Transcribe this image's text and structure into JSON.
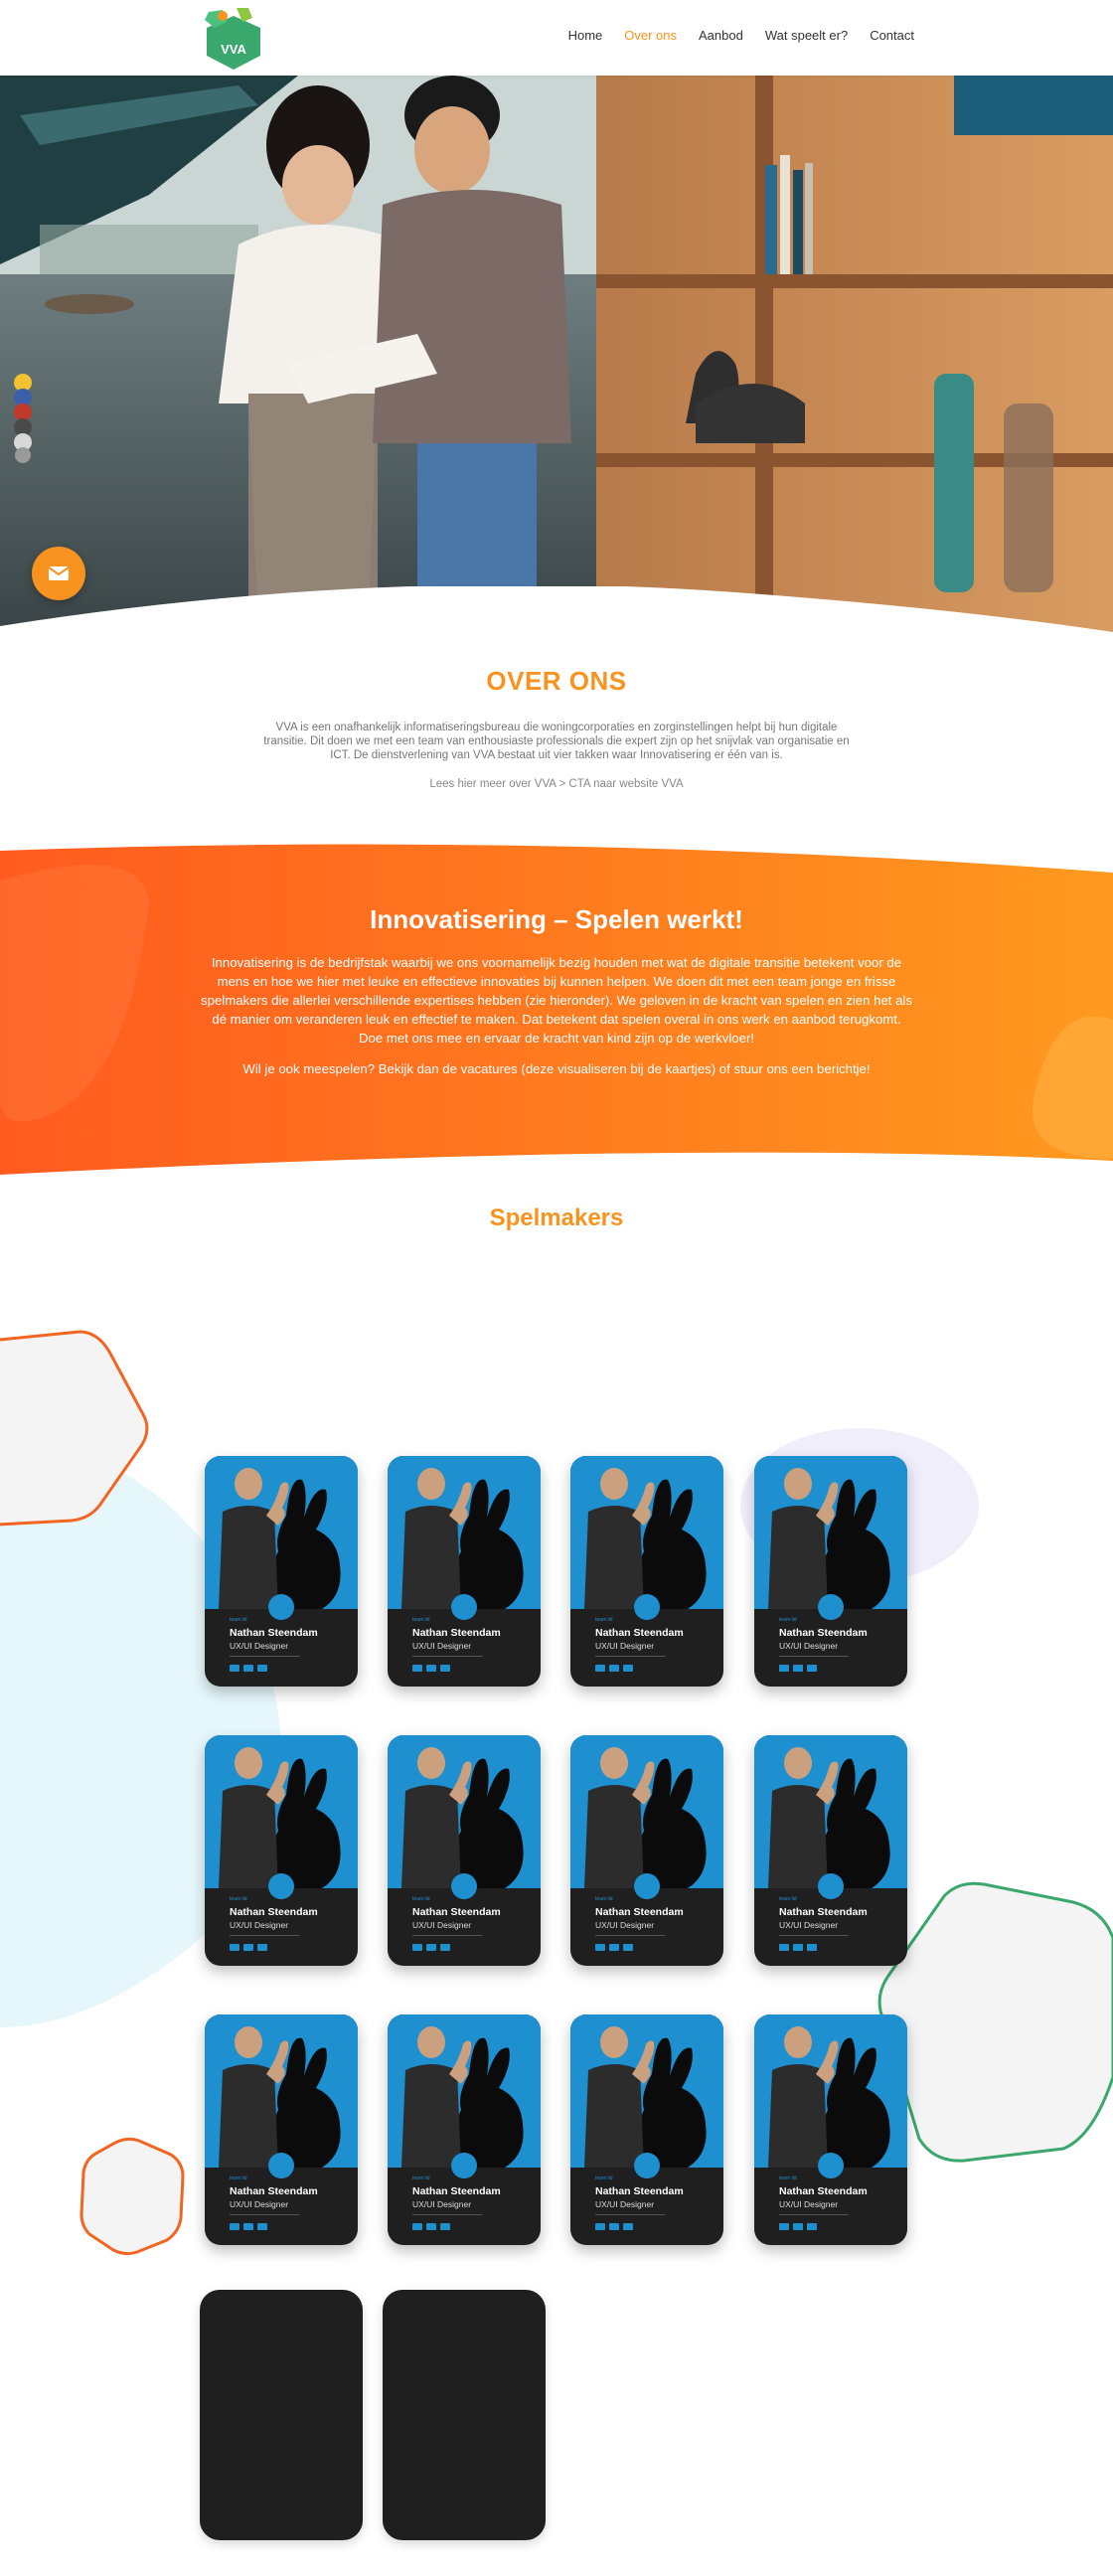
{
  "nav": {
    "logo_text": "VVA",
    "items": [
      {
        "label": "Home",
        "active": false
      },
      {
        "label": "Over ons",
        "active": true
      },
      {
        "label": "Aanbod",
        "active": false
      },
      {
        "label": "Wat speelt er?",
        "active": false
      },
      {
        "label": "Contact",
        "active": false
      }
    ]
  },
  "colors": {
    "accent": "#f7931e",
    "band_start": "#ff5a1f",
    "band_end": "#ff9a1f",
    "card_bg": "#1f1f1f",
    "photo_bg": "#1e8fcf",
    "hex_orange": "#f26522",
    "hex_green": "#3aa76d"
  },
  "over_ons": {
    "title": "OVER ONS",
    "body": "VVA is een onafhankelijk informatiseringsbureau die woningcorporaties en zorginstellingen helpt bij hun digitale transitie. Dit doen we met een team van enthousiaste professionals die expert zijn op het snijvlak van organisatie en ICT. De dienstverlening van VVA bestaat uit vier takken waar Innovatisering er één van is.",
    "link": "Lees hier meer over VVA > CTA naar website VVA"
  },
  "innovatie": {
    "title": "Innovatisering – Spelen werkt!",
    "body": "Innovatisering is de bedrijfstak waarbij we ons voornamelijk bezig houden met wat de digitale transitie betekent voor de mens en hoe we hier met leuke en effectieve innovaties bij kunnen helpen. We doen dit met een team jonge en frisse spelmakers die allerlei verschillende expertises hebben (zie hieronder). We geloven in de kracht van spelen en zien het als dé manier om veranderen leuk en effectief te maken. Dat betekent dat spelen overal in ons werk en aanbod terugkomt. Doe met ons mee en ervaar de kracht van kind zijn op de werkvloer!",
    "cta": "Wil je ook meespelen? Bekijk dan de vacatures (deze visualiseren bij de kaartjes) of stuur ons een berichtje!"
  },
  "team": {
    "title": "Spelmakers",
    "members": [
      {
        "tag": "team lid",
        "name": "Nathan Steendam",
        "role": "UX/UI Designer"
      },
      {
        "tag": "team lid",
        "name": "Nathan Steendam",
        "role": "UX/UI Designer"
      },
      {
        "tag": "team lid",
        "name": "Nathan Steendam",
        "role": "UX/UI Designer"
      },
      {
        "tag": "team lid",
        "name": "Nathan Steendam",
        "role": "UX/UI Designer"
      },
      {
        "tag": "team lid",
        "name": "Nathan Steendam",
        "role": "UX/UI Designer"
      },
      {
        "tag": "team lid",
        "name": "Nathan Steendam",
        "role": "UX/UI Designer"
      },
      {
        "tag": "team lid",
        "name": "Nathan Steendam",
        "role": "UX/UI Designer"
      },
      {
        "tag": "team lid",
        "name": "Nathan Steendam",
        "role": "UX/UI Designer"
      },
      {
        "tag": "team lid",
        "name": "Nathan Steendam",
        "role": "UX/UI Designer"
      },
      {
        "tag": "team lid",
        "name": "Nathan Steendam",
        "role": "UX/UI Designer"
      },
      {
        "tag": "team lid",
        "name": "Nathan Steendam",
        "role": "UX/UI Designer"
      },
      {
        "tag": "team lid",
        "name": "Nathan Steendam",
        "role": "UX/UI Designer"
      }
    ],
    "placeholder_cards": 2
  },
  "icons": [
    "envelope-icon",
    "linkedin-icon"
  ]
}
